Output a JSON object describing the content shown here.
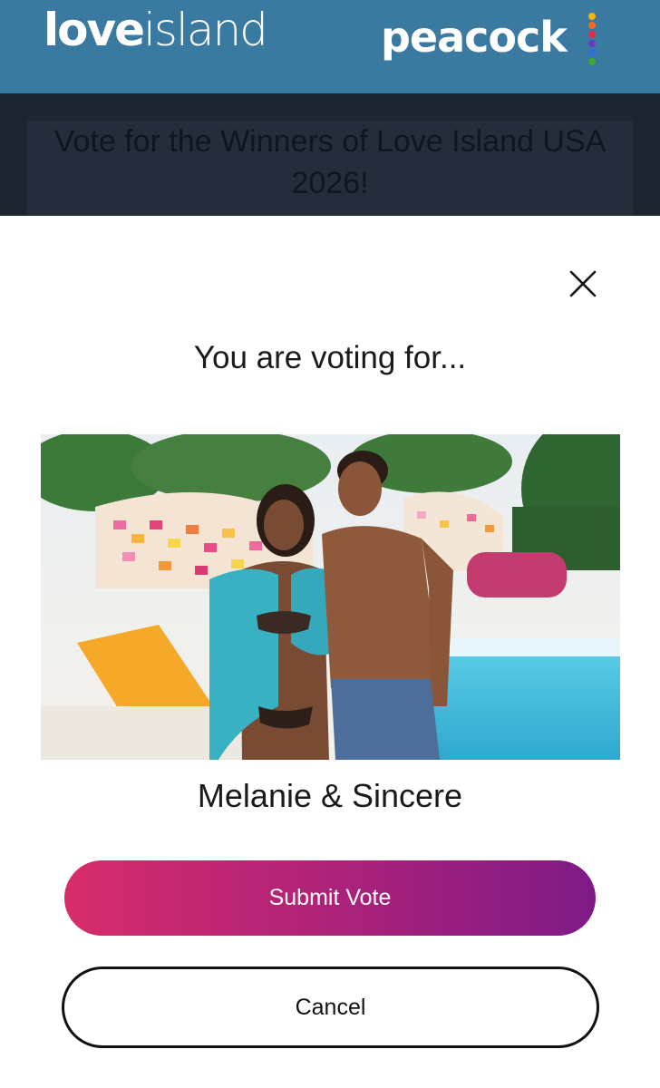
{
  "header": {
    "logo_love": "love",
    "logo_island": "island",
    "logo_peacock": "peacock",
    "peacock_dot_colors": [
      "#f5b400",
      "#f26b21",
      "#e12d4a",
      "#6f3bc0",
      "#2f6fd8",
      "#3aaa35"
    ]
  },
  "background_page": {
    "title": "Vote for the Winners of Love Island USA 2026!"
  },
  "modal": {
    "heading": "You are voting for...",
    "couple_name": "Melanie & Sincere",
    "photo_icon": "couple-photo",
    "close_icon": "close-icon",
    "submit_label": "Submit Vote",
    "cancel_label": "Cancel"
  },
  "colors": {
    "header_bg": "#3a7aa0",
    "submit_gradient_start": "#d72c6a",
    "submit_gradient_end": "#7e1a86"
  }
}
